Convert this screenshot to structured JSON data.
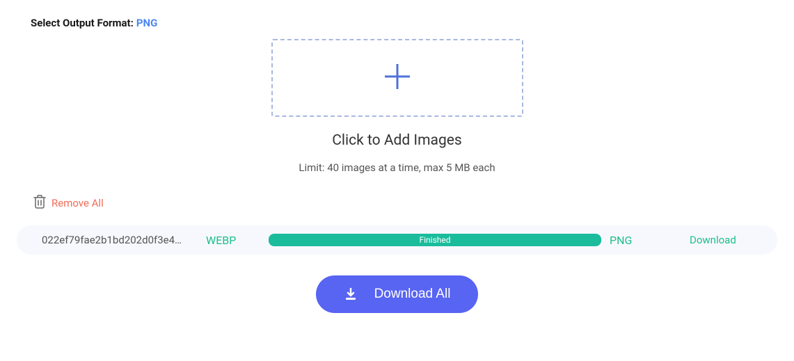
{
  "formatSelector": {
    "label": "Select Output Format:",
    "value": "PNG"
  },
  "upload": {
    "title": "Click to Add Images",
    "limit": "Limit: 40 images at a time, max 5 MB each"
  },
  "removeAll": {
    "label": "Remove All"
  },
  "files": [
    {
      "name": "022ef79fae2b1bd202d0f3e4…",
      "fromFormat": "WEBP",
      "status": "Finished",
      "toFormat": "PNG",
      "action": "Download"
    }
  ],
  "downloadAll": {
    "label": "Download All"
  }
}
